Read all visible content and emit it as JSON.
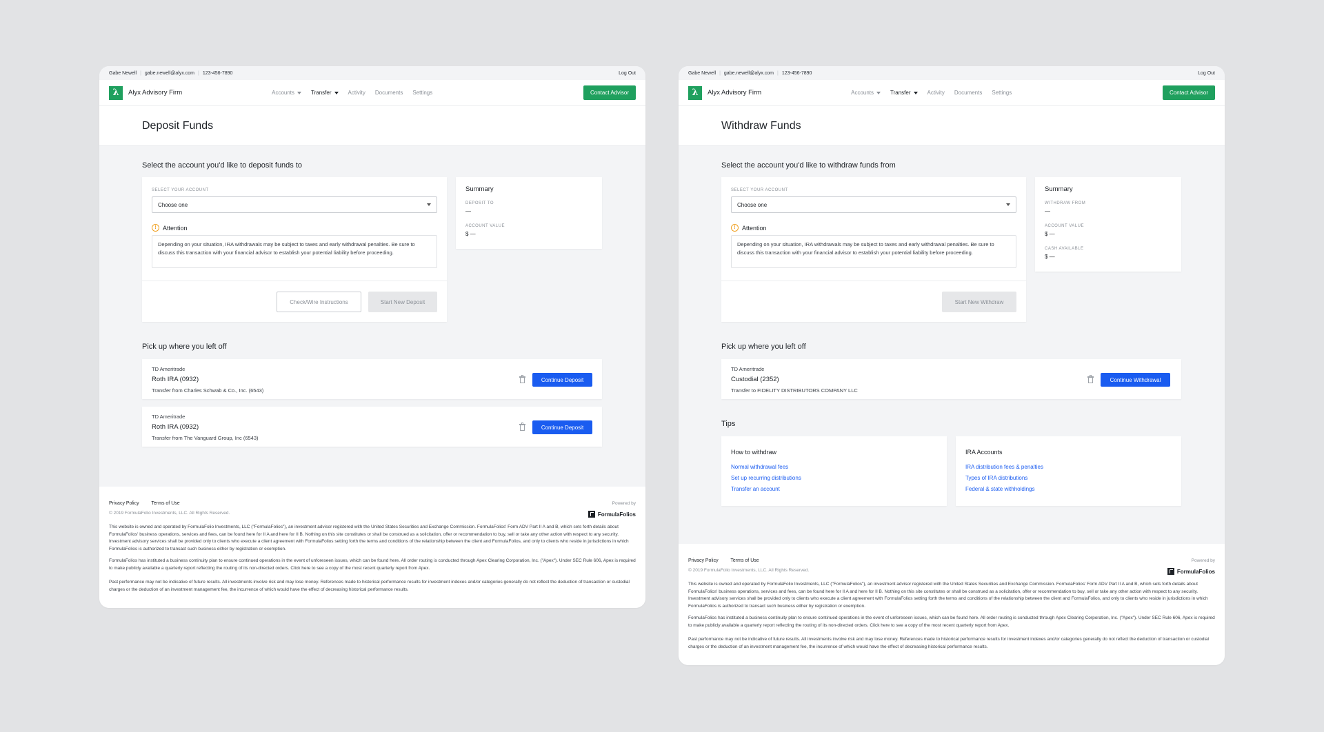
{
  "topbar": {
    "user_name": "Gabe Newell",
    "email": "gabe.newell@alyx.com",
    "phone": "123-456-7890",
    "logout": "Log Out"
  },
  "nav": {
    "logo_glyph": "λ",
    "firm": "Alyx Advisory Firm",
    "items": [
      "Accounts",
      "Transfer",
      "Activity",
      "Documents",
      "Settings"
    ],
    "active": "Transfer",
    "contact": "Contact Advisor"
  },
  "colors": {
    "brand_green": "#1fa05e",
    "link_blue": "#1a5cf0",
    "attention": "#f0a020"
  },
  "icons": [
    "lambda-logo-icon",
    "chevron-down-icon",
    "attention-icon",
    "trash-icon",
    "formulafolios-logo-icon"
  ],
  "deposit": {
    "title": "Deposit Funds",
    "select_heading": "Select the account you'd like to deposit funds to",
    "select_label": "SELECT YOUR ACCOUNT",
    "select_value": "Choose one",
    "attention_title": "Attention",
    "attention_text": "Depending on your situation, IRA withdrawals may be subject to taxes and early withdrawal penalties. Be sure to discuss this transaction with your financial advisor to establish your potential liability before proceeding.",
    "check_wire": "Check/Wire Instructions",
    "start": "Start New Deposit",
    "summary": {
      "title": "Summary",
      "deposit_to_label": "DEPOSIT TO",
      "deposit_to_value": "—",
      "account_value_label": "ACCOUNT VALUE",
      "account_value": "$ —"
    },
    "pickup_title": "Pick up where you left off",
    "pending": [
      {
        "provider": "TD Ameritrade",
        "account": "Roth IRA (0932)",
        "desc": "Transfer from Charles Schwab & Co., Inc. (6543)",
        "action": "Continue Deposit"
      },
      {
        "provider": "TD Ameritrade",
        "account": "Roth IRA (0932)",
        "desc": "Transfer from The Vanguard Group, Inc (6543)",
        "action": "Continue Deposit"
      }
    ]
  },
  "withdraw": {
    "title": "Withdraw Funds",
    "select_heading": "Select the account you'd like to withdraw funds from",
    "select_label": "SELECT YOUR ACCOUNT",
    "select_value": "Choose one",
    "attention_title": "Attention",
    "attention_text": "Depending on your situation, IRA withdrawals may be subject to taxes and early withdrawal penalties. Be sure to discuss this transaction with your financial advisor to establish your potential liability before proceeding.",
    "start": "Start New Withdraw",
    "summary": {
      "title": "Summary",
      "withdraw_from_label": "WITHDRAW FROM",
      "withdraw_from_value": "—",
      "account_value_label": "ACCOUNT VALUE",
      "account_value": "$ —",
      "cash_label": "CASH AVAILABLE",
      "cash_value": "$ —"
    },
    "pickup_title": "Pick up where you left off",
    "pending": [
      {
        "provider": "TD Ameritrade",
        "account": "Custodial (2352)",
        "desc": "Transfer to FIDELITY DISTRIBUTORS COMPANY LLC",
        "action": "Continue Withdrawal"
      }
    ],
    "tips_title": "Tips",
    "tips": [
      {
        "title": "How to withdraw",
        "links": [
          "Normal withdrawal fees",
          "Set up recurring distributions",
          "Transfer an account"
        ]
      },
      {
        "title": "IRA Accounts",
        "links": [
          "IRA distribution fees & penalties",
          "Types of IRA distributions",
          "Federal & state withholdings"
        ]
      }
    ]
  },
  "footer": {
    "privacy": "Privacy Policy",
    "terms": "Terms of Use",
    "copyright": "© 2019 FormulaFolio Investments, LLC. All Rights Reserved.",
    "powered_by": "Powered by",
    "brand": "FormulaFolios",
    "legal_1": "This website is owned and operated by FormulaFolio Investments, LLC (\"FormulaFolios\"), an investment advisor registered with the United States Securities and Exchange Commission. FormulaFolios' Form ADV Part II A and B, which sets forth details about FormulaFolios' business operations, services and fees, can be found here for II A and here for II B. Nothing on this site constitutes or shall be construed as a solicitation, offer or recommendation to buy, sell or take any other action with respect to any security. Investment advisory services shall be provided only to clients who execute a client agreement with FormulaFolios setting forth the terms and conditions of the relationship between the client and FormulaFolios, and only to clients who reside in jurisdictions in which FormulaFolios is authorized to transact such business either by registration or exemption.",
    "legal_2": "FormulaFolios has instituted a business continuity plan to ensure continued operations in the event of unforeseen issues, which can be found here. All order routing is conducted through Apex Clearing Corporation, Inc. (\"Apex\"). Under SEC Rule 606, Apex is required to make publicly available a quarterly report reflecting the routing of its non-directed orders. Click here to see a copy of the most recent quarterly report from Apex.",
    "legal_3": "Past performance may not be indicative of future results. All investments involve risk and may lose money. References made to historical performance results for investment indexes and/or categories generally do not reflect the deduction of transaction or custodial charges or the deduction of an investment management fee, the incurrence of which would have the effect of decreasing historical performance results."
  }
}
